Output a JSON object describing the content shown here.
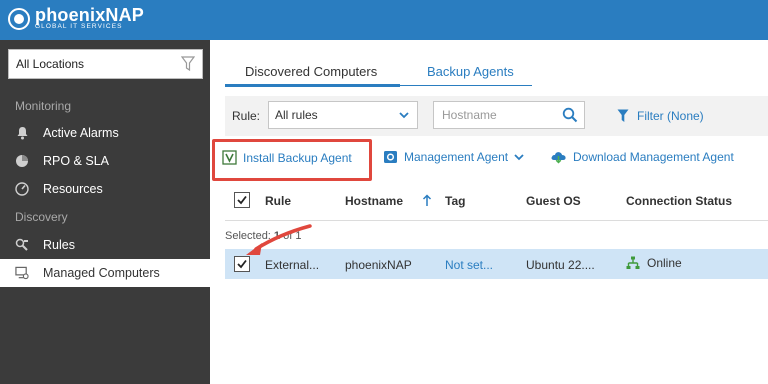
{
  "brand": {
    "name": "phoenixNAP",
    "tagline": "GLOBAL IT SERVICES",
    "color": "#2a7dc0"
  },
  "sidebar": {
    "location_select": "All Locations",
    "sections": [
      {
        "title": "Monitoring",
        "items": [
          {
            "label": "Active Alarms",
            "icon": "bell-icon"
          },
          {
            "label": "RPO & SLA",
            "icon": "pie-chart-icon"
          },
          {
            "label": "Resources",
            "icon": "gauge-icon"
          }
        ]
      },
      {
        "title": "Discovery",
        "items": [
          {
            "label": "Rules",
            "icon": "rules-icon"
          },
          {
            "label": "Managed Computers",
            "icon": "computer-gear-icon",
            "active": true
          }
        ]
      }
    ]
  },
  "tabs": [
    {
      "label": "Discovered Computers",
      "active": true
    },
    {
      "label": "Backup Agents",
      "active": false
    }
  ],
  "filters": {
    "rule_label": "Rule:",
    "rule_value": "All rules",
    "hostname_placeholder": "Hostname",
    "filter_label": "Filter (None)"
  },
  "actions": {
    "install": "Install Backup Agent",
    "management": "Management Agent",
    "download": "Download Management Agent"
  },
  "table": {
    "columns": [
      "Rule",
      "Hostname",
      "Tag",
      "Guest OS",
      "Connection Status"
    ],
    "selected_prefix": "Selected: ",
    "selected_count": "1",
    "selected_suffix": " of 1",
    "rows": [
      {
        "rule": "External...",
        "hostname": "phoenixNAP",
        "tag": "Not set...",
        "guest_os": "Ubuntu 22....",
        "status": "Online",
        "checked": true
      }
    ]
  },
  "colors": {
    "accent": "#2a7dc0",
    "sidebar_bg": "#3b3b3b",
    "highlight": "#e0473d",
    "row_selected": "#cfe4f6",
    "online": "#3f9a3b"
  }
}
